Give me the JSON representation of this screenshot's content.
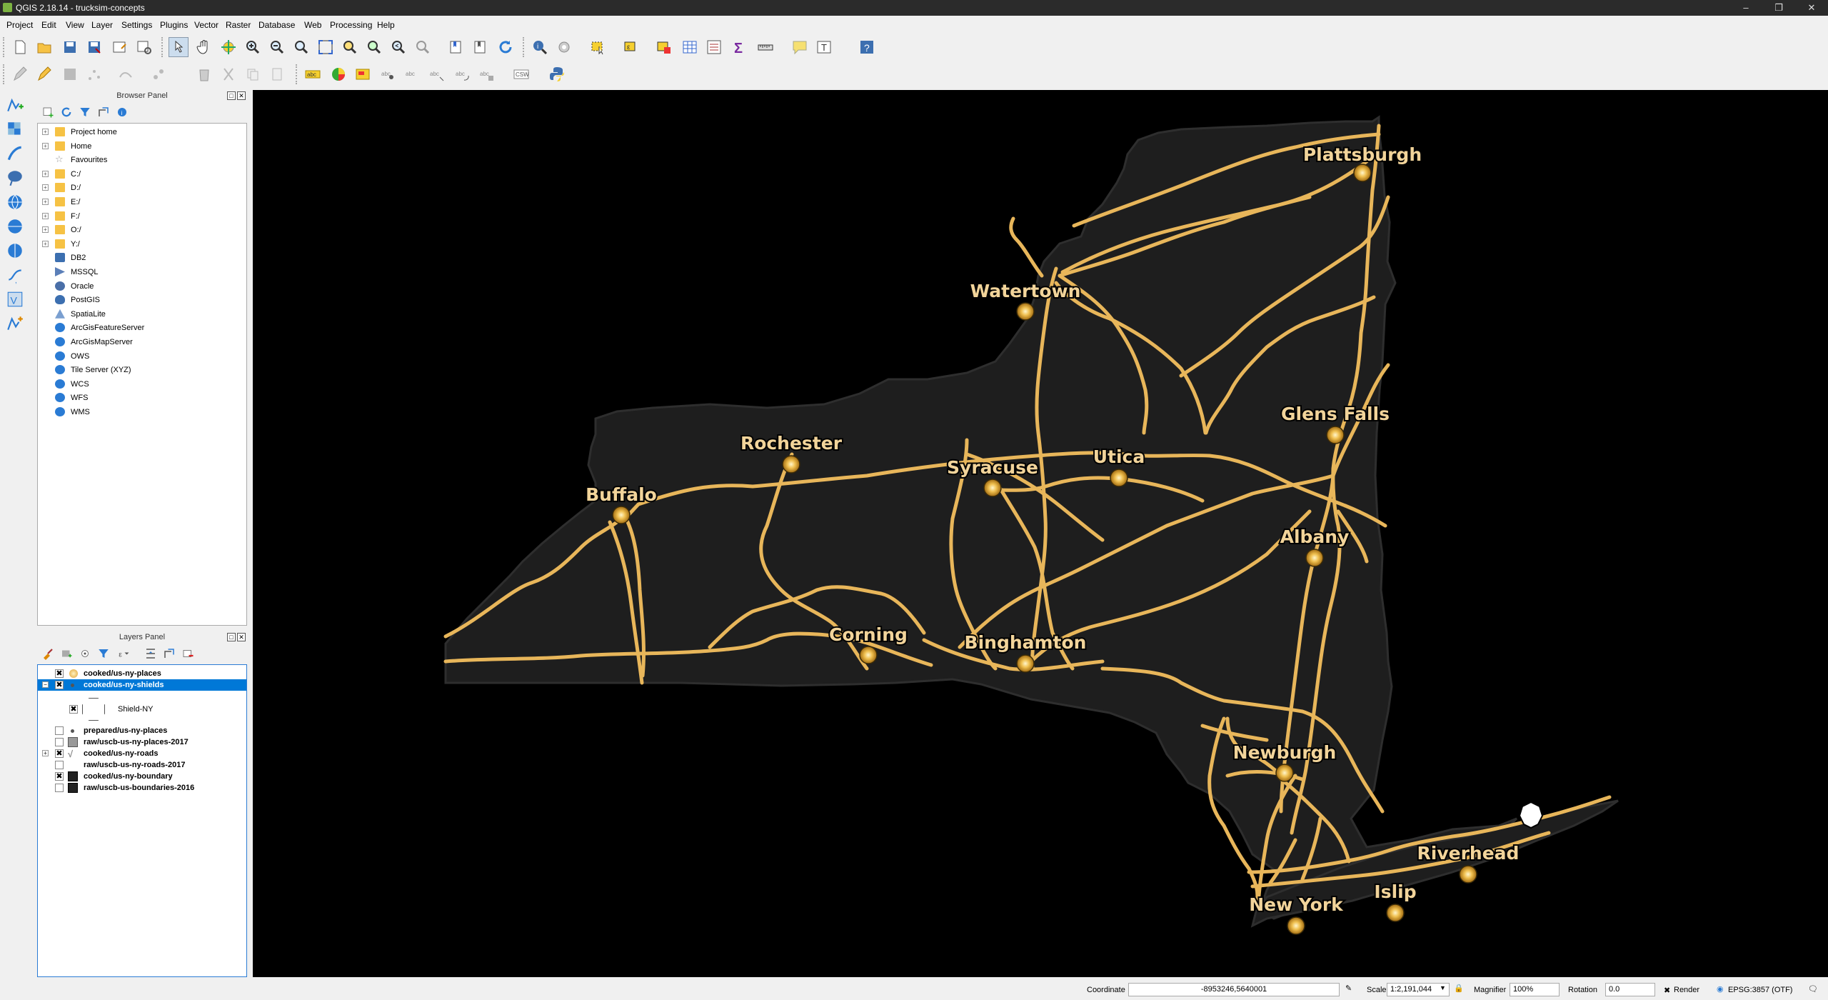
{
  "window": {
    "title": "QGIS 2.18.14 - trucksim-concepts"
  },
  "menu": [
    "Project",
    "Edit",
    "View",
    "Layer",
    "Settings",
    "Plugins",
    "Vector",
    "Raster",
    "Database",
    "Web",
    "Processing",
    "Help"
  ],
  "browser_panel": {
    "title": "Browser Panel",
    "items": [
      {
        "label": "Project home",
        "icon": "folder-icon",
        "expandable": true
      },
      {
        "label": "Home",
        "icon": "folder-icon",
        "expandable": true
      },
      {
        "label": "Favourites",
        "icon": "star-icon",
        "expandable": false
      },
      {
        "label": "C:/",
        "icon": "folder-icon",
        "expandable": true
      },
      {
        "label": "D:/",
        "icon": "folder-icon",
        "expandable": true
      },
      {
        "label": "E:/",
        "icon": "folder-icon",
        "expandable": true
      },
      {
        "label": "F:/",
        "icon": "folder-icon",
        "expandable": true
      },
      {
        "label": "O:/",
        "icon": "folder-icon",
        "expandable": true
      },
      {
        "label": "Y:/",
        "icon": "folder-icon",
        "expandable": true
      },
      {
        "label": "DB2",
        "icon": "db2-icon",
        "expandable": false
      },
      {
        "label": "MSSQL",
        "icon": "mssql-icon",
        "expandable": false
      },
      {
        "label": "Oracle",
        "icon": "oracle-icon",
        "expandable": false
      },
      {
        "label": "PostGIS",
        "icon": "postgis-icon",
        "expandable": false
      },
      {
        "label": "SpatiaLite",
        "icon": "spatialite-icon",
        "expandable": false
      },
      {
        "label": "ArcGisFeatureServer",
        "icon": "globe-icon",
        "expandable": false
      },
      {
        "label": "ArcGisMapServer",
        "icon": "globe-icon",
        "expandable": false
      },
      {
        "label": "OWS",
        "icon": "globe-icon",
        "expandable": false
      },
      {
        "label": "Tile Server (XYZ)",
        "icon": "globe-icon",
        "expandable": false
      },
      {
        "label": "WCS",
        "icon": "globe-icon",
        "expandable": false
      },
      {
        "label": "WFS",
        "icon": "globe-icon",
        "expandable": false
      },
      {
        "label": "WMS",
        "icon": "globe-icon",
        "expandable": false
      }
    ]
  },
  "layers_panel": {
    "title": "Layers Panel",
    "layers": [
      {
        "name": "cooked/us-ny-places",
        "checked": true,
        "selected": false,
        "symbol": "point-orange"
      },
      {
        "name": "cooked/us-ny-shields",
        "checked": true,
        "selected": true,
        "symbol": "point-small"
      },
      {
        "name": "Shield-NY",
        "checked": true,
        "selected": false,
        "symbol": "shield"
      },
      {
        "name": "prepared/us-ny-places",
        "checked": false,
        "selected": false,
        "symbol": "point-small"
      },
      {
        "name": "raw/uscb-us-ny-places-2017",
        "checked": false,
        "selected": false,
        "symbol": "poly-gray"
      },
      {
        "name": "cooked/us-ny-roads",
        "checked": true,
        "selected": false,
        "symbol": "line"
      },
      {
        "name": "raw/uscb-us-ny-roads-2017",
        "checked": false,
        "selected": false,
        "symbol": "none"
      },
      {
        "name": "cooked/us-ny-boundary",
        "checked": true,
        "selected": false,
        "symbol": "poly-black"
      },
      {
        "name": "raw/uscb-us-boundaries-2016",
        "checked": false,
        "selected": false,
        "symbol": "poly-black"
      }
    ]
  },
  "map": {
    "background": "#000000",
    "land_color": "#1e1e1e",
    "road_color": "#e8b65a",
    "cities": [
      {
        "name": "Plattsburgh"
      },
      {
        "name": "Watertown"
      },
      {
        "name": "Glens Falls"
      },
      {
        "name": "Rochester"
      },
      {
        "name": "Syracuse"
      },
      {
        "name": "Utica"
      },
      {
        "name": "Buffalo"
      },
      {
        "name": "Albany"
      },
      {
        "name": "Corning"
      },
      {
        "name": "Binghamton"
      },
      {
        "name": "Newburgh"
      },
      {
        "name": "Riverhead"
      },
      {
        "name": "Islip"
      },
      {
        "name": "New York"
      }
    ]
  },
  "statusbar": {
    "coordinate_label": "Coordinate",
    "coordinate_value": "-8953246,5640001",
    "scale_label": "Scale",
    "scale_value": "1:2,191,044",
    "magnifier_label": "Magnifier",
    "magnifier_value": "100%",
    "rotation_label": "Rotation",
    "rotation_value": "0.0",
    "render_label": "Render",
    "crs": "EPSG:3857 (OTF)"
  }
}
